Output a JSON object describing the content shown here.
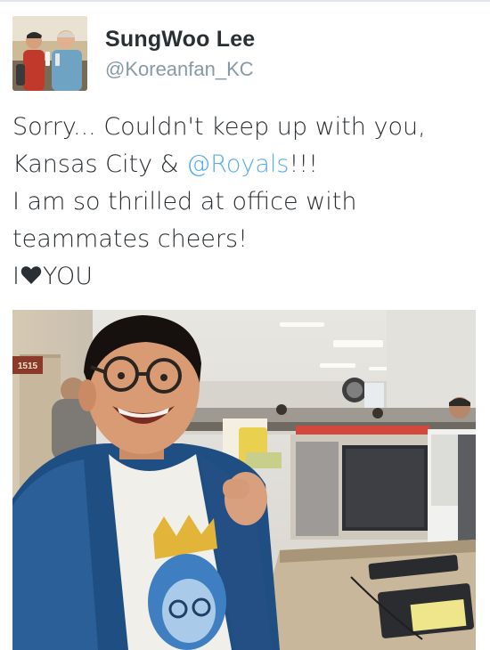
{
  "tweet": {
    "author": {
      "display_name": "SungWoo Lee",
      "handle": "@Koreanfan_KC"
    },
    "text_lines": [
      [
        "Sorry... Couldn't keep up with you,"
      ],
      [
        "Kansas City & ",
        "@Royals",
        "!!!"
      ],
      [
        "I am so thrilled at office with"
      ],
      [
        "teammates cheers!"
      ],
      [
        "I",
        "YOU"
      ]
    ],
    "mention": "@Royals",
    "photo": {
      "sign_text": "1515"
    }
  },
  "colors": {
    "text": "#292f33",
    "secondary": "#8899a6",
    "link": "#55acee",
    "heart": "#292f33"
  },
  "icons": {
    "heart": "heart-icon"
  }
}
